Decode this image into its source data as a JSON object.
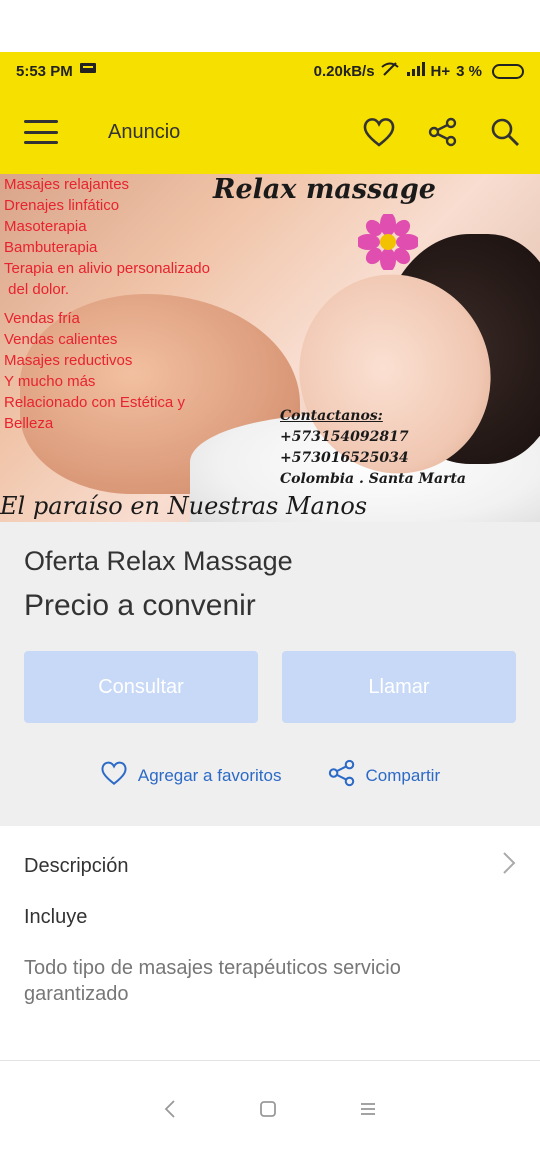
{
  "status_bar": {
    "time": "5:53 PM",
    "speed": "0.20kB/s",
    "network": "H+",
    "battery": "3 %"
  },
  "app_bar": {
    "title": "Anuncio",
    "icons": [
      "menu-icon",
      "heart-icon",
      "share-icon",
      "search-icon"
    ]
  },
  "ad_image": {
    "headline": "Relax massage",
    "services": [
      "Masajes relajantes",
      "Drenajes linfático",
      "Masoterapia",
      "Bambuterapia",
      "Terapia en alivio personalizado",
      " del dolor.",
      "Vendas fría",
      "Vendas calientes",
      "Masajes reductivos",
      "Y mucho más",
      "Relacionado con Estética y",
      "Belleza"
    ],
    "contact_label": "Contactanos:",
    "phone1": "+573154092817",
    "phone2": "+573016525034",
    "location": "Colombia . Santa Marta",
    "tagline": "El paraíso en Nuestras Manos"
  },
  "offer": {
    "title": "Oferta Relax Massage",
    "price": "Precio a convenir",
    "consult_label": "Consultar",
    "call_label": "Llamar",
    "favorite_label": "Agregar a favoritos",
    "share_label": "Compartir"
  },
  "description": {
    "heading": "Descripción",
    "subheading": "Incluye",
    "body": "Todo tipo de masajes terapéuticos servicio garantizado"
  },
  "colors": {
    "accent_yellow": "#f6e000",
    "link_blue": "#2c6ac7",
    "button_disabled": "#c7d9f6",
    "ad_red": "#e8232f"
  }
}
